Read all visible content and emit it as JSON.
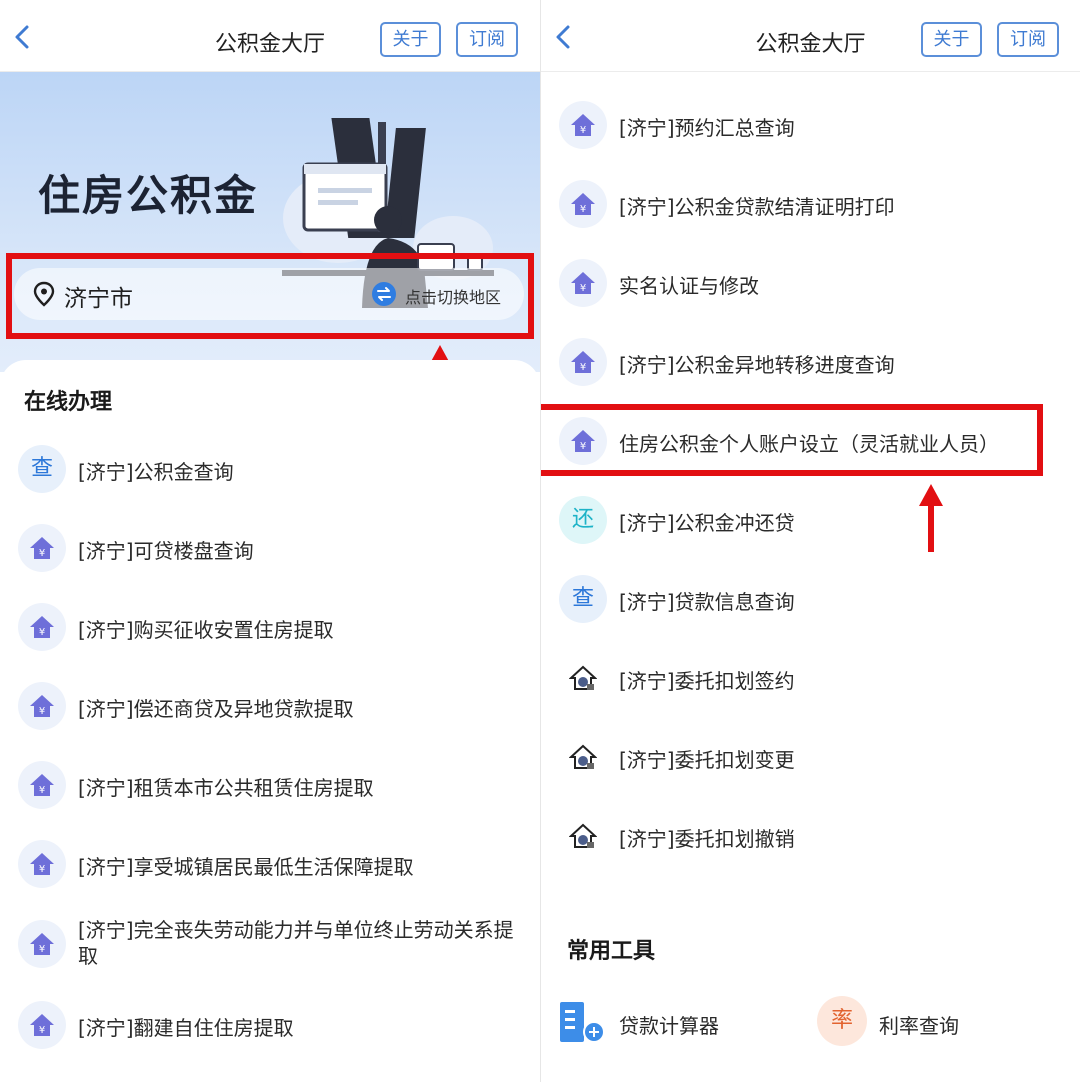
{
  "left": {
    "nav": {
      "title": "公积金大厅",
      "about_label": "关于",
      "subscribe_label": "订阅"
    },
    "hero": {
      "title": "住房公积金",
      "city": "济宁市",
      "switch_label": "点击切换地区"
    },
    "section_title": "在线办理",
    "items": [
      {
        "icon": "cha",
        "icon_text": "查",
        "label": "[济宁]公积金查询"
      },
      {
        "icon": "house-yuan-icon",
        "label": "[济宁]可贷楼盘查询"
      },
      {
        "icon": "house-yuan-icon",
        "label": "[济宁]购买征收安置住房提取"
      },
      {
        "icon": "house-yuan-icon",
        "label": "[济宁]偿还商贷及异地贷款提取"
      },
      {
        "icon": "house-yuan-icon",
        "label": "[济宁]租赁本市公共租赁住房提取"
      },
      {
        "icon": "house-yuan-icon",
        "label": "[济宁]享受城镇居民最低生活保障提取"
      },
      {
        "icon": "house-yuan-icon",
        "label": "[济宁]完全丧失劳动能力并与单位终止劳动关系提取"
      },
      {
        "icon": "house-yuan-icon",
        "label": "[济宁]翻建自住住房提取"
      }
    ]
  },
  "right": {
    "nav": {
      "title": "公积金大厅",
      "about_label": "关于",
      "subscribe_label": "订阅"
    },
    "items": [
      {
        "icon": "house-yuan-icon",
        "label": "[济宁]预约汇总查询"
      },
      {
        "icon": "house-yuan-icon",
        "label": "[济宁]公积金贷款结清证明打印"
      },
      {
        "icon": "house-yuan-icon",
        "label": "实名认证与修改"
      },
      {
        "icon": "house-yuan-icon",
        "label": "[济宁]公积金异地转移进度查询"
      },
      {
        "icon": "house-yuan-icon",
        "label": "住房公积金个人账户设立（灵活就业人员）"
      },
      {
        "icon": "huan",
        "icon_text": "还",
        "label": "[济宁]公积金冲还贷"
      },
      {
        "icon": "cha",
        "icon_text": "查",
        "label": "[济宁]贷款信息查询"
      },
      {
        "icon": "house-outline-icon",
        "label": "[济宁]委托扣划签约"
      },
      {
        "icon": "house-outline-icon",
        "label": "[济宁]委托扣划变更"
      },
      {
        "icon": "house-outline-icon",
        "label": "[济宁]委托扣划撤销"
      }
    ],
    "tools_title": "常用工具",
    "tools": [
      {
        "icon": "building-calculator-icon",
        "label": "贷款计算器"
      },
      {
        "icon": "lv",
        "icon_text": "率",
        "label": "利率查询"
      }
    ]
  },
  "colors": {
    "accent": "#2f7de1",
    "highlight": "#e20f12",
    "icon_purple": "#6e6fd9"
  }
}
